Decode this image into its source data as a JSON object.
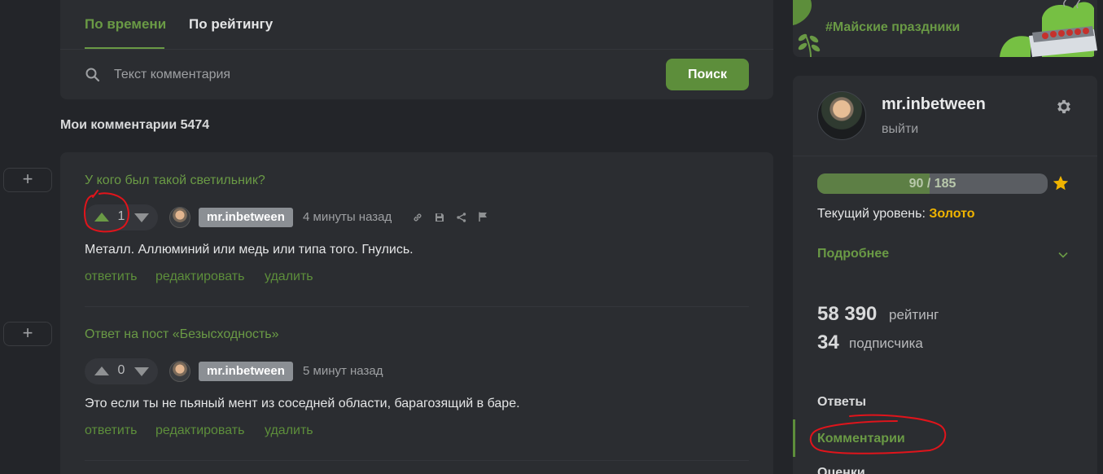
{
  "tabs": [
    {
      "label": "По времени",
      "active": true
    },
    {
      "label": "По рейтингу",
      "active": false
    }
  ],
  "search": {
    "placeholder": "Текст комментария",
    "button_label": "Поиск"
  },
  "my_comments_label": "Мои комментарии 5474",
  "comments": [
    {
      "title": "У кого был такой светильник?",
      "rating": "1",
      "upvoted": true,
      "author": "mr.inbetween",
      "time": "4 минуты назад",
      "tools": [
        "link-icon",
        "save-icon",
        "share-icon",
        "flag-icon"
      ],
      "text": "Металл. Аллюминий или медь или типа того. Гнулись.",
      "actions": [
        "ответить",
        "редактировать",
        "удалить"
      ]
    },
    {
      "title": "Ответ на пост «Безысходность»",
      "rating": "0",
      "upvoted": false,
      "author": "mr.inbetween",
      "time": "5 минут назад",
      "tools": [],
      "text": "Это если ты не пьяный мент из соседней области, барагозящий в баре.",
      "actions": [
        "ответить",
        "редактировать",
        "удалить"
      ]
    }
  ],
  "expand_label": "+",
  "banner": {
    "text": "#Майские праздники"
  },
  "profile": {
    "username": "mr.inbetween",
    "logout": "выйти",
    "progress_text": "90 / 185",
    "progress_fraction": 0.486,
    "level_prefix": "Текущий уровень: ",
    "level_value": "Золото",
    "details_label": "Подробнее",
    "rating_value": "58 390",
    "rating_label": "рейтинг",
    "subscribers_value": "34",
    "subscribers_label": "подписчика",
    "nav": [
      {
        "label": "Ответы",
        "active": false
      },
      {
        "label": "Комментарии",
        "active": true
      },
      {
        "label": "Оценки",
        "active": false
      }
    ]
  },
  "colors": {
    "accent_green": "#6a9a45",
    "button_green": "#5d8e3b",
    "gold": "#f0b400",
    "background": "#232529",
    "card": "#2b2d31",
    "annotation_red": "#e0141b"
  }
}
